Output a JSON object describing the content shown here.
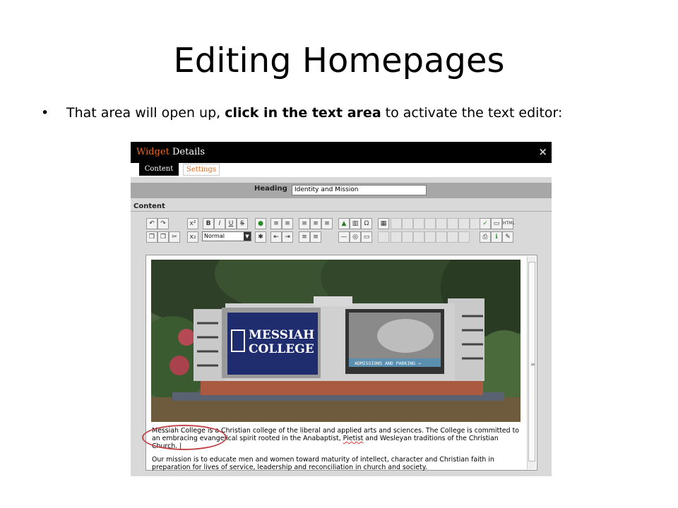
{
  "slide": {
    "title": "Editing Homepages",
    "bullet_prefix": "That area will open up, ",
    "bullet_bold": "click in the text area",
    "bullet_suffix": " to activate the text editor:"
  },
  "widget": {
    "title_part1": "Widget",
    "title_part2": " Details",
    "close": "×",
    "tabs": [
      {
        "label": "Content"
      },
      {
        "label": "Settings"
      }
    ],
    "heading_label": "Heading",
    "heading_value": "Identity and Mission",
    "content_label": "Content",
    "format_select": "Normal",
    "sign_text_1": "MESSIAH",
    "sign_text_2": "COLLEGE",
    "sign_banner": "ADMISSIONS AND PARKING →",
    "paragraph1_a": "Messiah College is a Christian college of the liberal and applied arts and sciences. The College is committed to",
    "paragraph1_b1": "an embracing evangelical spirit rooted in the Anabaptist, ",
    "paragraph1_b2": "Pietist",
    "paragraph1_b3": " and Wesleyan traditions of the Christian",
    "paragraph1_c": "Church.",
    "paragraph2_a": "Our mission is to educate men and women toward maturity of intellect, character and Christian faith in",
    "paragraph2_b": "preparation for lives of service, leadership and reconciliation in church and society."
  },
  "colors": {
    "accent": "#e66a1e",
    "titlebar": "#000000",
    "sign_panel": "#1f2d6e"
  },
  "icons": [
    "undo-icon",
    "redo-icon",
    "superscript-icon",
    "subscript-icon",
    "bold-icon",
    "italic-icon",
    "underline-icon",
    "strikethrough-icon",
    "link-icon",
    "ordered-list-icon",
    "unordered-list-icon",
    "align-left-icon",
    "align-center-icon",
    "align-right-icon",
    "image-icon",
    "media-icon",
    "omega-icon",
    "table-icon",
    "spellcheck-icon",
    "html-icon"
  ]
}
